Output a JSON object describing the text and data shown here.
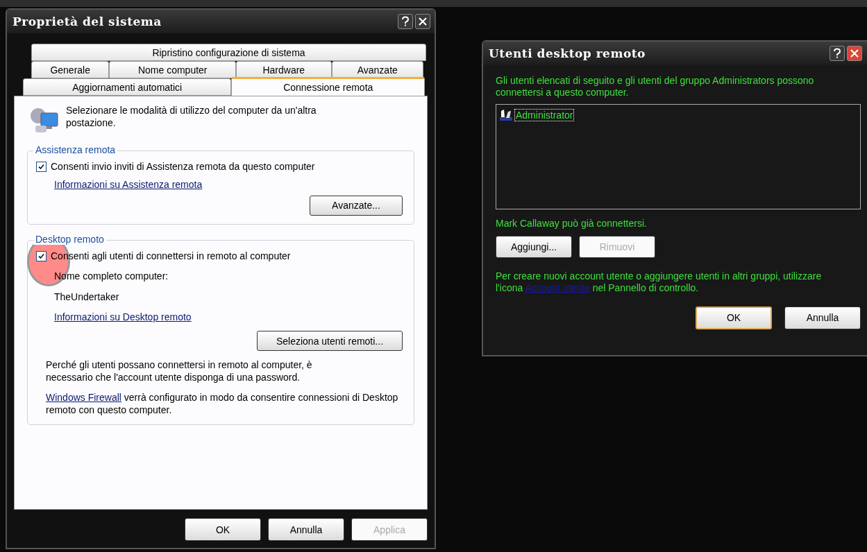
{
  "system_window": {
    "title": "Proprietà del sistema",
    "tab_rows": [
      [
        {
          "label": "Ripristino configurazione di sistema",
          "selected": false
        }
      ],
      [
        {
          "label": "Generale",
          "selected": false
        },
        {
          "label": "Nome computer",
          "selected": false
        },
        {
          "label": "Hardware",
          "selected": false
        },
        {
          "label": "Avanzate",
          "selected": false
        }
      ],
      [
        {
          "label": "Aggiornamenti automatici",
          "selected": false
        },
        {
          "label": "Connessione remota",
          "selected": true
        }
      ]
    ],
    "intro": "Selezionare le modalità di utilizzo del computer da un'altra postazione.",
    "remote_assistance": {
      "legend": "Assistenza remota",
      "checkbox": {
        "label": "Consenti invio inviti di Assistenza remota da questo computer",
        "checked": true
      },
      "link": "Informazioni su Assistenza remota",
      "button": "Avanzate..."
    },
    "remote_desktop": {
      "legend": "Desktop remoto",
      "checkbox": {
        "label": "Consenti agli utenti di connettersi in remoto al computer",
        "checked": true,
        "highlighted": true
      },
      "computer_name_label": "Nome completo computer:",
      "computer_name": "TheUndertaker",
      "link": "Informazioni su Desktop remoto",
      "button": "Seleziona utenti remoti...",
      "note": "Perché gli utenti possano connettersi in remoto al computer, è necessario che l'account utente disponga di una password.",
      "firewall_link": "Windows Firewall",
      "firewall_text": " verrà configurato in modo da consentire connessioni di Desktop remoto con questo computer."
    },
    "buttons": [
      {
        "label": "OK",
        "disabled": false
      },
      {
        "label": "Annulla",
        "disabled": false
      },
      {
        "label": "Applica",
        "disabled": true
      }
    ]
  },
  "users_window": {
    "title": "Utenti desktop remoto",
    "description": "Gli utenti elencati di seguito e gli utenti del gruppo Administrators possono connettersi a questo computer.",
    "users": [
      {
        "name": "Administrator",
        "selected": true
      }
    ],
    "status": "Mark Callaway può già connettersi.",
    "list_buttons": [
      {
        "label": "Aggiungi...",
        "disabled": false
      },
      {
        "label": "Rimuovi",
        "disabled": true
      }
    ],
    "hint_before": "Per creare nuovi account utente o aggiungere utenti in altri gruppi, utilizzare l'icona ",
    "hint_link": "Account utente",
    "hint_after": " nel Pannello di controllo.",
    "buttons": [
      {
        "label": "OK",
        "default": true
      },
      {
        "label": "Annulla",
        "default": false
      }
    ]
  }
}
